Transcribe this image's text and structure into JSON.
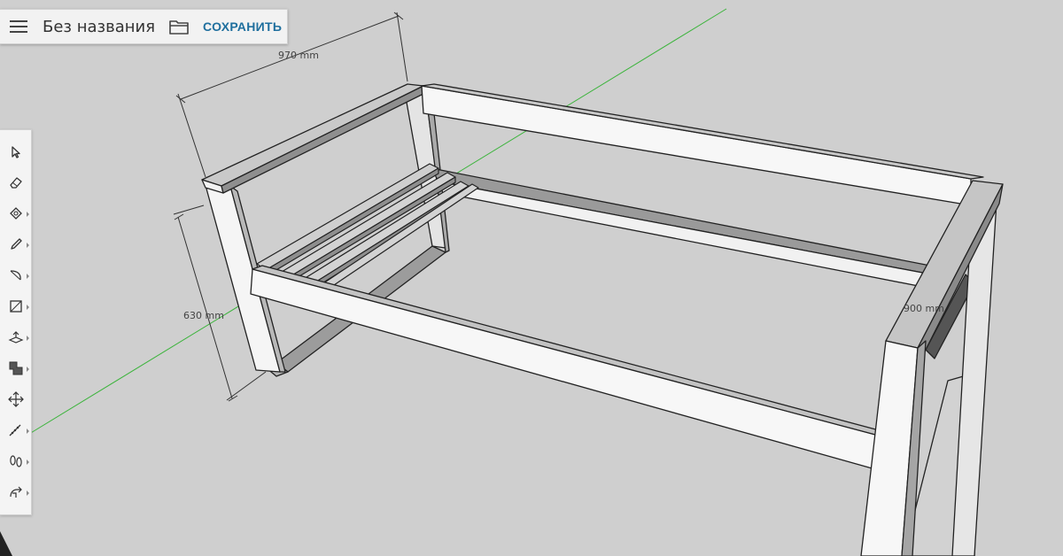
{
  "header": {
    "title": "Без названия",
    "save_label": "СОХРАНИТЬ",
    "menu_icon": "hamburger-menu-icon",
    "folder_icon": "folder-icon"
  },
  "toolbar": {
    "tools": [
      {
        "name": "select-tool",
        "icon": "select-arrow-icon"
      },
      {
        "name": "eraser-tool",
        "icon": "eraser-icon"
      },
      {
        "name": "paint-tool",
        "icon": "paint-bucket-icon"
      },
      {
        "name": "line-tool",
        "icon": "pencil-icon"
      },
      {
        "name": "arc-tool",
        "icon": "arc-icon"
      },
      {
        "name": "rectangle-tool",
        "icon": "rectangle-icon"
      },
      {
        "name": "push-pull-tool",
        "icon": "push-pull-icon"
      },
      {
        "name": "offset-tool",
        "icon": "offset-icon"
      },
      {
        "name": "move-tool",
        "icon": "move-icon"
      },
      {
        "name": "tape-measure-tool",
        "icon": "tape-measure-icon"
      },
      {
        "name": "walk-tool",
        "icon": "footprints-icon"
      },
      {
        "name": "orbit-tool",
        "icon": "orbit-hand-icon"
      }
    ]
  },
  "dimensions": {
    "width": "970 mm",
    "depth": "630 mm",
    "side": "900 mm"
  },
  "colors": {
    "background": "#cfcfcf",
    "axis_green": "#3cb43c",
    "accent": "#1f6f9e"
  }
}
